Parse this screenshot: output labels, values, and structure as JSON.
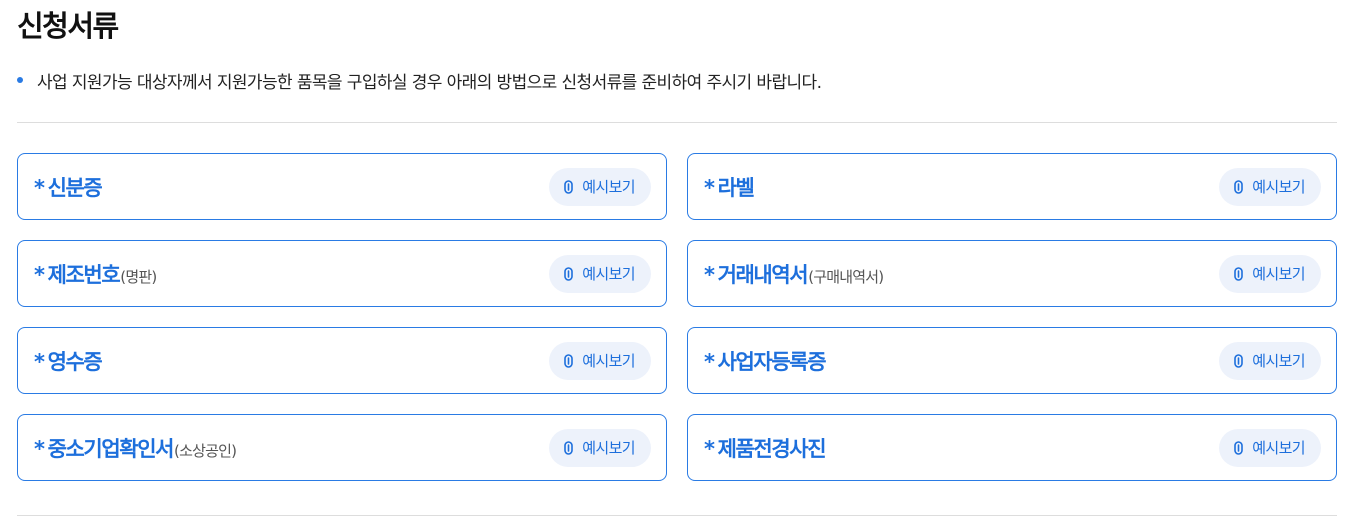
{
  "page": {
    "title": "신청서류",
    "notice": "사업 지원가능 대상자께서 지원가능한 품목을 구입하실 경우 아래의 방법으로 신청서류를 준비하여 주시기 바랍니다."
  },
  "colors": {
    "accent": "#1d6fdc",
    "card_border": "#2a7be4",
    "button_bg": "#edf2fb",
    "divider": "#dddddd"
  },
  "documents": [
    {
      "asterisk": "*",
      "label": "신분증",
      "sub": "",
      "button": "예시보기",
      "icon": "paperclip-icon"
    },
    {
      "asterisk": "*",
      "label": "라벨",
      "sub": "",
      "button": "예시보기",
      "icon": "paperclip-icon"
    },
    {
      "asterisk": "*",
      "label": "제조번호",
      "sub": "(명판)",
      "button": "예시보기",
      "icon": "paperclip-icon"
    },
    {
      "asterisk": "*",
      "label": "거래내역서",
      "sub": "(구매내역서)",
      "button": "예시보기",
      "icon": "paperclip-icon"
    },
    {
      "asterisk": "*",
      "label": "영수증",
      "sub": "",
      "button": "예시보기",
      "icon": "paperclip-icon"
    },
    {
      "asterisk": "*",
      "label": "사업자등록증",
      "sub": "",
      "button": "예시보기",
      "icon": "paperclip-icon"
    },
    {
      "asterisk": "*",
      "label": "중소기업확인서",
      "sub": "(소상공인)",
      "button": "예시보기",
      "icon": "paperclip-icon"
    },
    {
      "asterisk": "*",
      "label": "제품전경사진",
      "sub": "",
      "button": "예시보기",
      "icon": "paperclip-icon"
    }
  ]
}
